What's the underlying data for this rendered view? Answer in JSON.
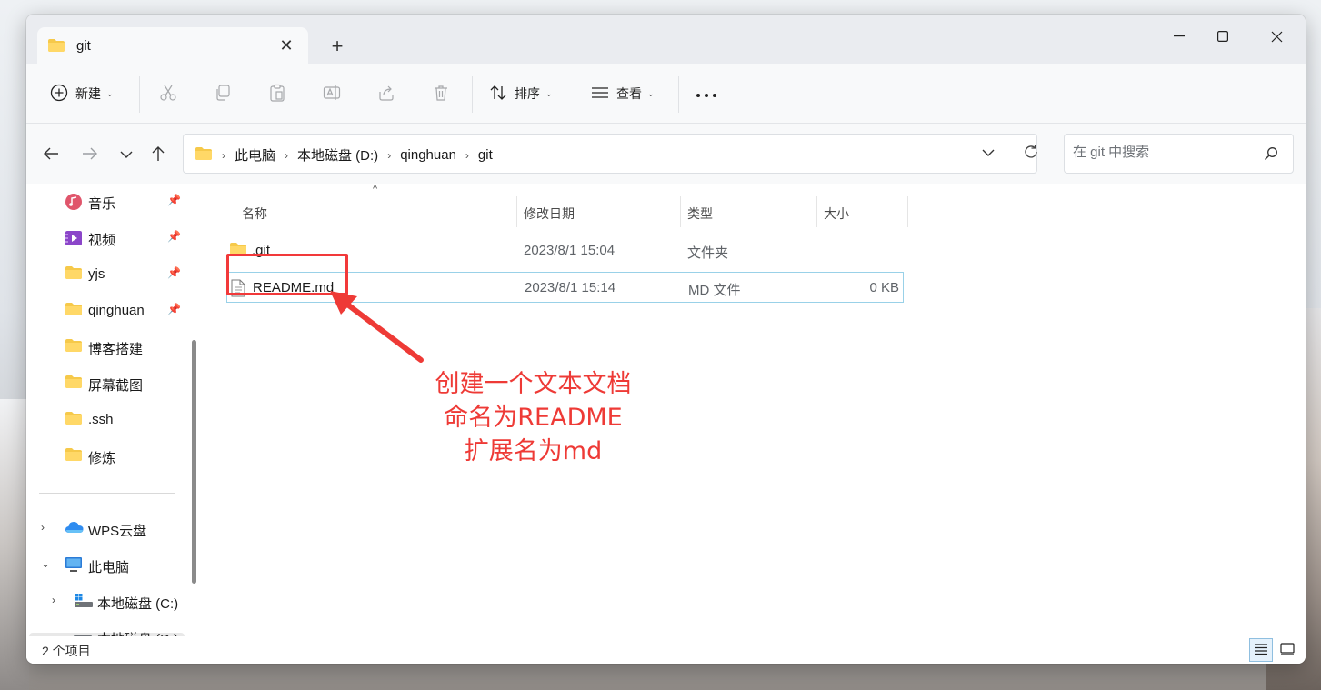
{
  "tab": {
    "title": "git"
  },
  "toolbar": {
    "new_label": "新建",
    "sort_label": "排序",
    "view_label": "查看"
  },
  "breadcrumb": [
    "此电脑",
    "本地磁盘 (D:)",
    "qinghuan",
    "git"
  ],
  "search": {
    "placeholder": "在 git 中搜索"
  },
  "sidebar": {
    "quick": [
      {
        "label": "音乐",
        "icon": "music-icon",
        "pinned": true
      },
      {
        "label": "视频",
        "icon": "video-icon",
        "pinned": true
      },
      {
        "label": "yjs",
        "icon": "folder-icon",
        "pinned": true
      },
      {
        "label": "qinghuan",
        "icon": "folder-icon",
        "pinned": true
      },
      {
        "label": "博客搭建",
        "icon": "folder-icon",
        "pinned": false
      },
      {
        "label": "屏幕截图",
        "icon": "folder-icon",
        "pinned": false
      },
      {
        "label": ".ssh",
        "icon": "folder-icon",
        "pinned": false
      },
      {
        "label": "修炼",
        "icon": "folder-icon",
        "pinned": false
      }
    ],
    "wps": "WPS云盘",
    "thispc": "此电脑",
    "drive_c": "本地磁盘 (C:)",
    "drive_d": "本地磁盘 (D:)"
  },
  "columns": {
    "name": "名称",
    "date": "修改日期",
    "type": "类型",
    "size": "大小"
  },
  "files": [
    {
      "name": ".git",
      "date": "2023/8/1 15:04",
      "type": "文件夹",
      "size": ""
    },
    {
      "name": "README.md",
      "date": "2023/8/1 15:14",
      "type": "MD 文件",
      "size": "0 KB"
    }
  ],
  "annotation": {
    "lines": [
      "创建一个文本文档",
      "命名为README",
      "扩展名为md"
    ],
    "color": "#ee3a36"
  },
  "status": {
    "count": "2 个项目"
  },
  "colors": {
    "accent": "#0067c0",
    "folder": "#f6c94a",
    "selection_border": "#99d1e8"
  }
}
